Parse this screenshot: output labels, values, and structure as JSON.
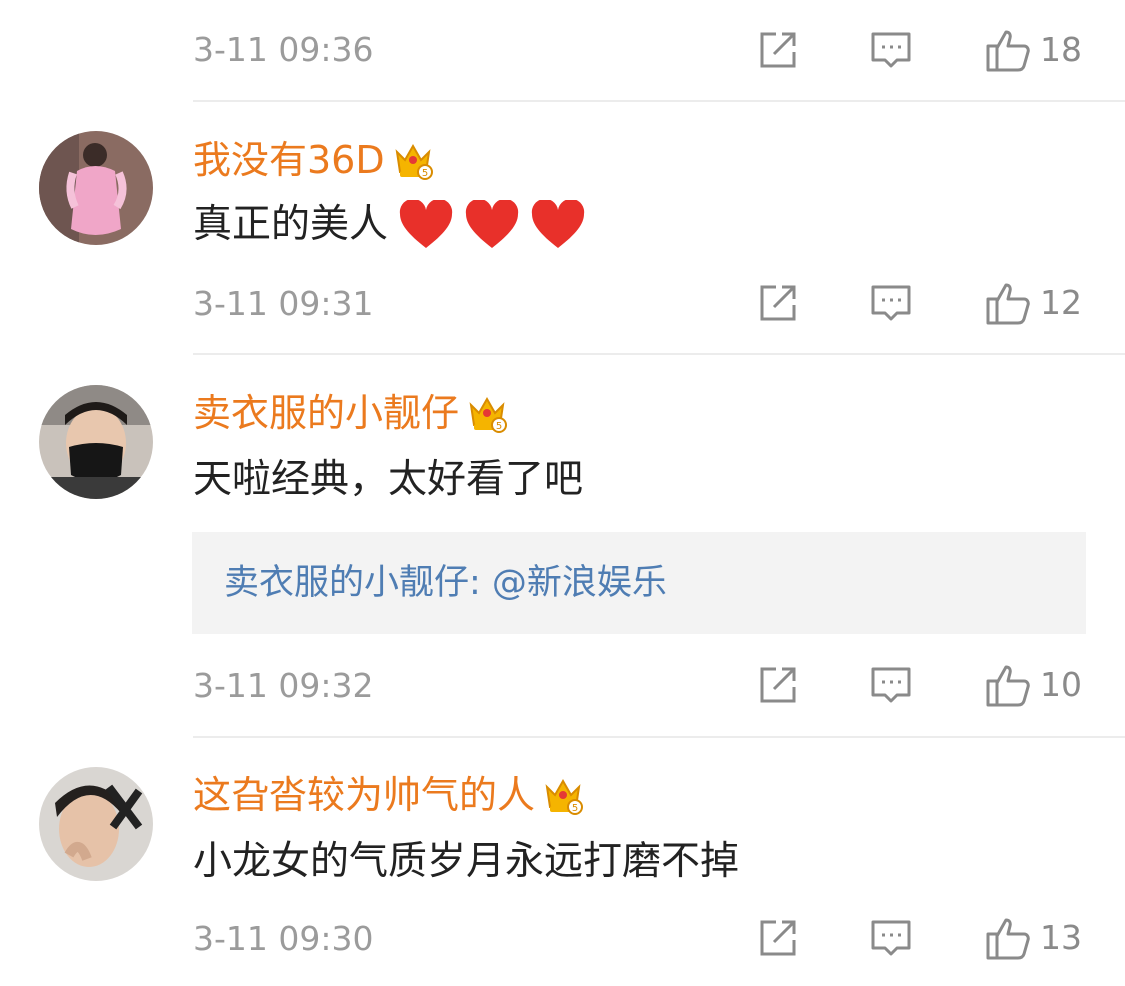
{
  "comments": [
    {
      "time": "3-11 09:36",
      "likes": "18"
    },
    {
      "user": "我没有36D",
      "text": "真正的美人",
      "hearts": 3,
      "time": "3-11 09:31",
      "likes": "12"
    },
    {
      "user": "卖衣服的小靓仔",
      "text": "天啦经典，太好看了吧",
      "reply": "卖衣服的小靓仔: @新浪娱乐",
      "time": "3-11 09:32",
      "likes": "10"
    },
    {
      "user": "这旮沓较为帅气的人",
      "text": "小龙女的气质岁月永远打磨不掉",
      "time": "3-11 09:30",
      "likes": "13"
    }
  ],
  "icons": {
    "repost": "repost-icon",
    "comment": "comment-icon",
    "like": "thumbs-up-icon",
    "badge": "crown-badge-icon",
    "heart": "red-heart-icon"
  },
  "colors": {
    "username": "#eb7a1e",
    "reply_link": "#4f7db3",
    "timestamp": "#9b9b9b",
    "text": "#222222"
  }
}
